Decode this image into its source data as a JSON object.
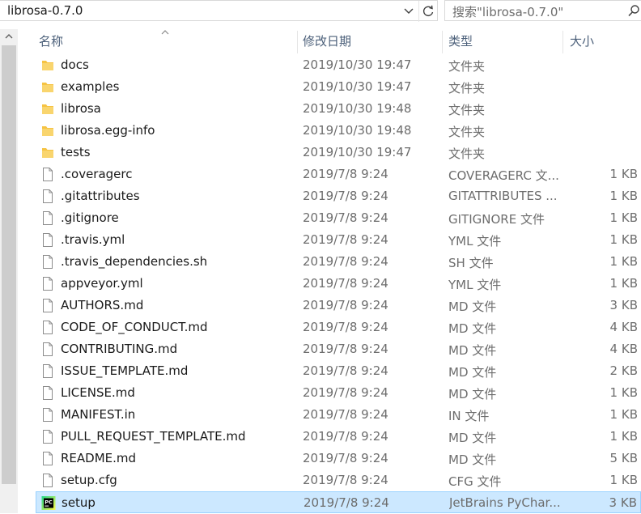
{
  "address_bar": {
    "path": "librosa-0.7.0"
  },
  "search": {
    "placeholder": "搜索\"librosa-0.7.0\""
  },
  "columns": {
    "name": "名称",
    "date": "修改日期",
    "type": "类型",
    "size": "大小"
  },
  "files": [
    {
      "name": "docs",
      "date": "2019/10/30 19:47",
      "type": "文件夹",
      "size": "",
      "icon": "folder-icon"
    },
    {
      "name": "examples",
      "date": "2019/10/30 19:47",
      "type": "文件夹",
      "size": "",
      "icon": "folder-icon"
    },
    {
      "name": "librosa",
      "date": "2019/10/30 19:48",
      "type": "文件夹",
      "size": "",
      "icon": "folder-icon"
    },
    {
      "name": "librosa.egg-info",
      "date": "2019/10/30 19:48",
      "type": "文件夹",
      "size": "",
      "icon": "folder-icon"
    },
    {
      "name": "tests",
      "date": "2019/10/30 19:47",
      "type": "文件夹",
      "size": "",
      "icon": "folder-icon"
    },
    {
      "name": ".coveragerc",
      "date": "2019/7/8 9:24",
      "type": "COVERAGERC 文...",
      "size": "1 KB",
      "icon": "file-icon"
    },
    {
      "name": ".gitattributes",
      "date": "2019/7/8 9:24",
      "type": "GITATTRIBUTES ...",
      "size": "1 KB",
      "icon": "file-icon"
    },
    {
      "name": ".gitignore",
      "date": "2019/7/8 9:24",
      "type": "GITIGNORE 文件",
      "size": "1 KB",
      "icon": "file-icon"
    },
    {
      "name": ".travis.yml",
      "date": "2019/7/8 9:24",
      "type": "YML 文件",
      "size": "1 KB",
      "icon": "file-icon"
    },
    {
      "name": ".travis_dependencies.sh",
      "date": "2019/7/8 9:24",
      "type": "SH 文件",
      "size": "1 KB",
      "icon": "file-icon"
    },
    {
      "name": "appveyor.yml",
      "date": "2019/7/8 9:24",
      "type": "YML 文件",
      "size": "1 KB",
      "icon": "file-icon"
    },
    {
      "name": "AUTHORS.md",
      "date": "2019/7/8 9:24",
      "type": "MD 文件",
      "size": "3 KB",
      "icon": "file-icon"
    },
    {
      "name": "CODE_OF_CONDUCT.md",
      "date": "2019/7/8 9:24",
      "type": "MD 文件",
      "size": "4 KB",
      "icon": "file-icon"
    },
    {
      "name": "CONTRIBUTING.md",
      "date": "2019/7/8 9:24",
      "type": "MD 文件",
      "size": "4 KB",
      "icon": "file-icon"
    },
    {
      "name": "ISSUE_TEMPLATE.md",
      "date": "2019/7/8 9:24",
      "type": "MD 文件",
      "size": "2 KB",
      "icon": "file-icon"
    },
    {
      "name": "LICENSE.md",
      "date": "2019/7/8 9:24",
      "type": "MD 文件",
      "size": "1 KB",
      "icon": "file-icon"
    },
    {
      "name": "MANIFEST.in",
      "date": "2019/7/8 9:24",
      "type": "IN 文件",
      "size": "1 KB",
      "icon": "file-icon"
    },
    {
      "name": "PULL_REQUEST_TEMPLATE.md",
      "date": "2019/7/8 9:24",
      "type": "MD 文件",
      "size": "1 KB",
      "icon": "file-icon"
    },
    {
      "name": "README.md",
      "date": "2019/7/8 9:24",
      "type": "MD 文件",
      "size": "5 KB",
      "icon": "file-icon"
    },
    {
      "name": "setup.cfg",
      "date": "2019/7/8 9:24",
      "type": "CFG 文件",
      "size": "1 KB",
      "icon": "file-icon"
    },
    {
      "name": "setup",
      "date": "2019/7/8 9:24",
      "type": "JetBrains PyChar...",
      "size": "3 KB",
      "icon": "pycharm-icon",
      "selected": true
    }
  ],
  "colors": {
    "folder": "#f6c343",
    "header_text": "#4c607a",
    "selection_bg": "#cce8ff",
    "selection_border": "#99d1ff"
  }
}
